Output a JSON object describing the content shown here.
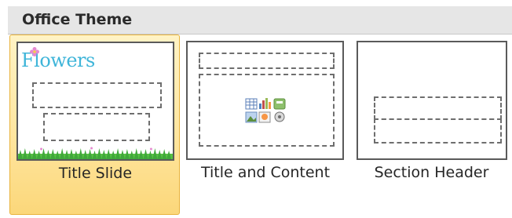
{
  "header": {
    "title": "Office Theme"
  },
  "layouts": [
    {
      "label": "Title Slide",
      "selected": true
    },
    {
      "label": "Title and Content",
      "selected": false
    },
    {
      "label": "Section Header",
      "selected": false
    }
  ],
  "thumbnail_decor": {
    "logo_text": "Flowers",
    "logo_color": "#3fb5d9",
    "grass_color": "#57c143",
    "flower_color": "#e58ad0"
  },
  "colors": {
    "selection_top": "#fff3c5",
    "selection_bottom": "#fbd77a",
    "selection_border": "#e8b33d",
    "header_bg": "#e6e6e6"
  },
  "icons": {
    "content_placeholder": "insert-content-icons"
  }
}
